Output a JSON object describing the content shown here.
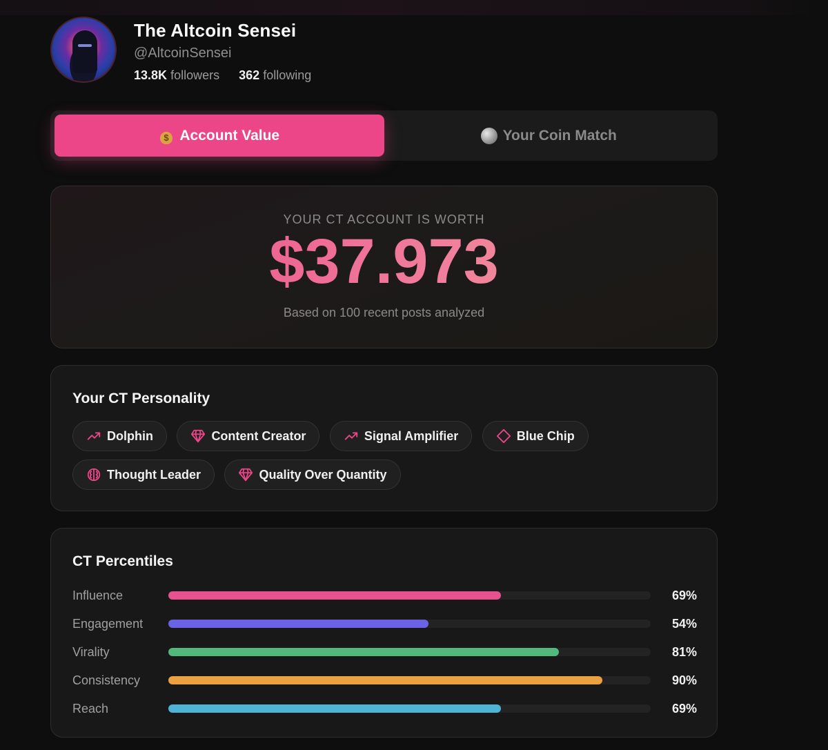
{
  "profile": {
    "name": "The Altcoin Sensei",
    "handle": "@AltcoinSensei",
    "followers_count": "13.8K",
    "followers_label": "followers",
    "following_count": "362",
    "following_label": "following"
  },
  "tabs": [
    {
      "label": "Account Value",
      "icon": "money-bag-icon",
      "active": true
    },
    {
      "label": "Your Coin Match",
      "icon": "moon-icon",
      "active": false
    }
  ],
  "worth": {
    "label": "YOUR CT ACCOUNT IS WORTH",
    "value": "$37.973",
    "subtext": "Based on 100 recent posts analyzed"
  },
  "personality": {
    "title": "Your CT Personality",
    "tags": [
      {
        "label": "Dolphin",
        "icon": "trending-up-icon"
      },
      {
        "label": "Content Creator",
        "icon": "gem-icon"
      },
      {
        "label": "Signal Amplifier",
        "icon": "trending-up-icon"
      },
      {
        "label": "Blue Chip",
        "icon": "diamond-icon"
      },
      {
        "label": "Thought Leader",
        "icon": "brain-icon"
      },
      {
        "label": "Quality Over Quantity",
        "icon": "gem-icon"
      }
    ]
  },
  "percentiles": {
    "title": "CT Percentiles",
    "rows": [
      {
        "label": "Influence",
        "value": 69,
        "display": "69%",
        "color": "#e8508e"
      },
      {
        "label": "Engagement",
        "value": 54,
        "display": "54%",
        "color": "#6b63e6"
      },
      {
        "label": "Virality",
        "value": 81,
        "display": "81%",
        "color": "#52b87c"
      },
      {
        "label": "Consistency",
        "value": 90,
        "display": "90%",
        "color": "#eba142"
      },
      {
        "label": "Reach",
        "value": 69,
        "display": "69%",
        "color": "#4fb3d6"
      }
    ]
  },
  "colors": {
    "accent": "#ec4688",
    "background": "#0e0e0e",
    "card": "#181818"
  }
}
